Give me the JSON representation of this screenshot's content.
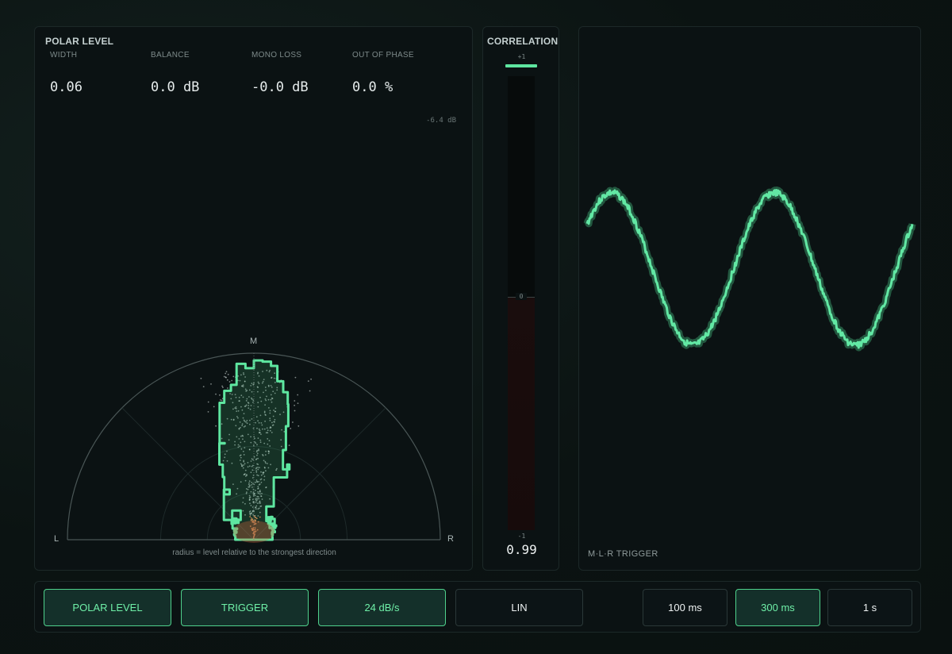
{
  "polar": {
    "title": "POLAR LEVEL",
    "stats": [
      {
        "label": "WIDTH",
        "value": "0.06"
      },
      {
        "label": "BALANCE",
        "value": "0.0 dB"
      },
      {
        "label": "MONO LOSS",
        "value": "-0.0 dB"
      },
      {
        "label": "OUT OF PHASE",
        "value": "0.0 %"
      }
    ],
    "db_readout": "-6.4 dB",
    "axis_m": "M",
    "axis_l": "L",
    "axis_r": "R",
    "caption": "radius = level relative to the strongest direction"
  },
  "correlation": {
    "title": "CORRELATION",
    "tick_top": "+1",
    "tick_mid": "0",
    "tick_bottom": "-1",
    "value": "0.99",
    "value_numeric": 0.99
  },
  "scope": {
    "mode_label": "M·L·R  TRIGGER"
  },
  "controls": {
    "polar_level": "POLAR LEVEL",
    "trigger": "TRIGGER",
    "decay": "24 dB/s",
    "scale": "LIN",
    "time_100": "100 ms",
    "time_300": "300 ms",
    "time_1s": "1 s"
  },
  "colors": {
    "accent": "#5ee6a0",
    "accent_text": "#6ff0a8",
    "panel_bg": "#0b1213",
    "negative_fill": "#1a0d0d"
  }
}
